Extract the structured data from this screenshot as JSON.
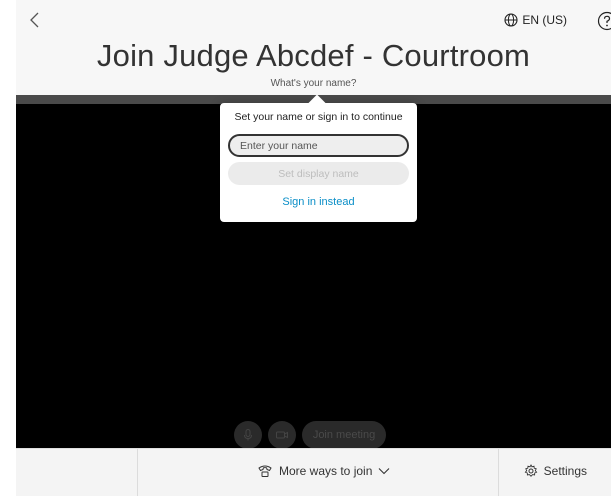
{
  "header": {
    "title": "Join Judge Abcdef - Courtroom",
    "prompt": "What's your name?",
    "language": "EN (US)"
  },
  "popover": {
    "heading": "Set your name or sign in to continue",
    "name_placeholder": "Enter your name",
    "set_display_name_label": "Set display name",
    "sign_in_label": "Sign in instead"
  },
  "controls": {
    "join_label": "Join meeting"
  },
  "bottom_bar": {
    "more_ways_label": "More ways to join",
    "settings_label": "Settings"
  },
  "colors": {
    "accent_link": "#0a8ec7",
    "video_background": "#000000"
  },
  "icons": [
    "chevron-left-icon",
    "globe-icon",
    "help-icon",
    "microphone-icon",
    "camera-icon",
    "phone-join-icon",
    "chevron-down-icon",
    "gear-icon"
  ]
}
